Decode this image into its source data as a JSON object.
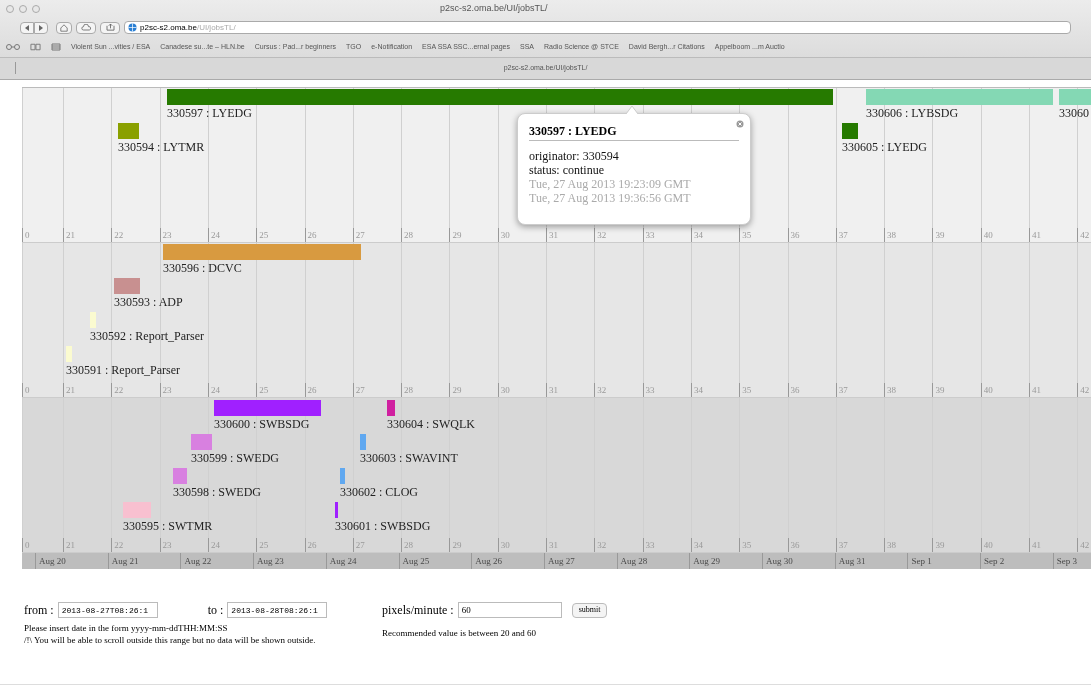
{
  "browser": {
    "title": "p2sc-s2.oma.be/UI/jobsTL/",
    "address_domain": "p2sc-s2.oma.be",
    "address_path": "/UI/jobsTL/",
    "bookmarks": [
      "Violent Sun ...vities / ESA",
      "Canadese su...te – HLN.be",
      "Cursus : Pad...r beginners",
      "TGO",
      "e-Notification",
      "ESA SSA SSC...ernal pages",
      "SSA",
      "Radio Science @ STCE",
      "David Bergh...r Citations",
      "Appelboom ...m Auctio"
    ],
    "tab_title": "p2sc-s2.oma.be/UI/jobsTL/"
  },
  "timeline": {
    "bands": [
      {
        "items": [
          {
            "label": "330597 : LYEDG",
            "color": "#267a00"
          },
          {
            "label": "330594 : LYTMR",
            "color": "#8aa000"
          },
          {
            "label": "330606 : LYBSDG",
            "color": "#84d8b4"
          },
          {
            "label": "33060",
            "color": "#84d8b4"
          },
          {
            "label": "330605 : LYEDG",
            "color": "#267a00"
          }
        ],
        "ticks": [
          "0",
          "21",
          "22",
          "23",
          "24",
          "25",
          "26",
          "27",
          "28",
          "29",
          "30",
          "31",
          "32",
          "33",
          "34",
          "35",
          "36",
          "37",
          "38",
          "39",
          "40",
          "41",
          "42"
        ]
      },
      {
        "items": [
          {
            "label": "330596 : DCVC",
            "color": "#d89a40"
          },
          {
            "label": "330593 : ADP",
            "color": "#c89090"
          },
          {
            "label": "330592 : Report_Parser",
            "color": "#fbfbd0"
          },
          {
            "label": "330591 : Report_Parser",
            "color": "#fbfbd0"
          }
        ],
        "ticks": [
          "0",
          "21",
          "22",
          "23",
          "24",
          "25",
          "26",
          "27",
          "28",
          "29",
          "30",
          "31",
          "32",
          "33",
          "34",
          "35",
          "36",
          "37",
          "38",
          "39",
          "40",
          "41",
          "42"
        ]
      },
      {
        "items": [
          {
            "label": "330600 : SWBSDG",
            "color": "#a020ff"
          },
          {
            "label": "330604 : SWQLK",
            "color": "#d020a0"
          },
          {
            "label": "330599 : SWEDG",
            "color": "#d880e0"
          },
          {
            "label": "330603 : SWAVINT",
            "color": "#60a8f0"
          },
          {
            "label": "330598 : SWEDG",
            "color": "#d880e0"
          },
          {
            "label": "330602 : CLOG",
            "color": "#60a8f0"
          },
          {
            "label": "330595 : SWTMR",
            "color": "#f8c0d0"
          },
          {
            "label": "330601 : SWBSDG",
            "color": "#a020ff"
          }
        ],
        "ticks": [
          "0",
          "21",
          "22",
          "23",
          "24",
          "25",
          "26",
          "27",
          "28",
          "29",
          "30",
          "31",
          "32",
          "33",
          "34",
          "35",
          "36",
          "37",
          "38",
          "39",
          "40",
          "41",
          "42"
        ]
      }
    ],
    "tooltip": {
      "title": "330597 : LYEDG",
      "lines": [
        "originator: 330594",
        "status: continue"
      ],
      "times": [
        "Tue, 27 Aug 2013 19:23:09 GMT",
        "Tue, 27 Aug 2013 19:36:56 GMT"
      ]
    },
    "dates": [
      "Aug 20",
      "Aug 21",
      "Aug 22",
      "Aug 23",
      "Aug 24",
      "Aug 25",
      "Aug 26",
      "Aug 27",
      "Aug 28",
      "Aug 29",
      "Aug 30",
      "Aug 31",
      "Sep 1",
      "Sep 2",
      "Sep 3"
    ]
  },
  "form": {
    "from_label": "from :",
    "from_value": "2013-08-27T08:26:1",
    "to_label": "to :",
    "to_value": "2013-08-28T08:26:1",
    "rate_label": "pixels/minute :",
    "rate_value": "60",
    "submit": "submit",
    "hints": [
      "Please insert date in the form yyyy-mm-ddTHH:MM:SS",
      "/!\\ You will be able to scroll outside this range but no data will be shown outside."
    ],
    "rate_hint": "Recommended value is between 20 and 60"
  }
}
